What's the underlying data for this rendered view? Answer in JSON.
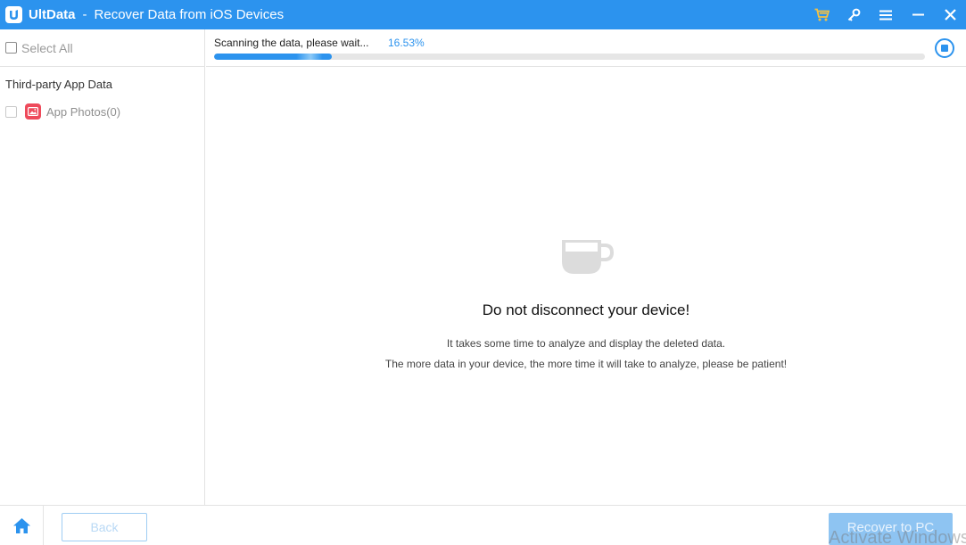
{
  "titlebar": {
    "app_name": "UltData",
    "separator": "-",
    "subtitle": "Recover Data from iOS Devices",
    "icons": [
      "cart-icon",
      "key-icon",
      "menu-icon",
      "minimize-icon",
      "close-icon"
    ]
  },
  "sidebar": {
    "select_all_label": "Select All",
    "category_label": "Third-party App Data",
    "items": [
      {
        "label": "App Photos(0)",
        "icon": "photo-icon"
      }
    ]
  },
  "scan": {
    "status_text": "Scanning the data, please wait...",
    "percent_text": "16.53%",
    "progress": 0.1653
  },
  "main": {
    "headline": "Do not disconnect your device!",
    "desc1": "It takes some time to analyze and display the deleted data.",
    "desc2": "The more data in your device, the more time it will take to analyze, please be patient!"
  },
  "footer": {
    "back_label": "Back",
    "recover_label": "Recover to PC"
  },
  "watermark": "Activate Windows",
  "colors": {
    "accent": "#2c93ee",
    "cart": "#f5c242",
    "photo_badge": "#ee4a5b"
  }
}
